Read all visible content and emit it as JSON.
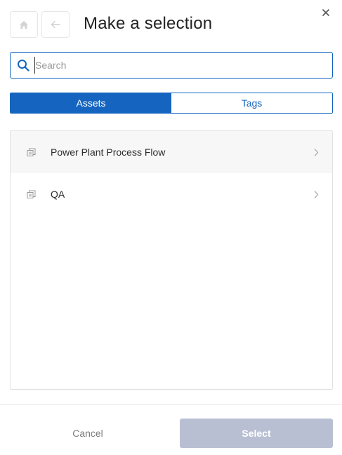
{
  "header": {
    "title": "Make a selection",
    "home_icon": "home-icon",
    "back_icon": "arrow-left-icon",
    "close_icon": "close-icon"
  },
  "search": {
    "placeholder": "Search",
    "value": "",
    "icon": "search-icon"
  },
  "tabs": [
    {
      "label": "Assets",
      "active": true
    },
    {
      "label": "Tags",
      "active": false
    }
  ],
  "list": {
    "items": [
      {
        "label": "Power Plant Process Flow",
        "icon": "asset-icon",
        "chevron": "chevron-right-icon"
      },
      {
        "label": "QA",
        "icon": "asset-icon",
        "chevron": "chevron-right-icon"
      }
    ]
  },
  "footer": {
    "cancel_label": "Cancel",
    "select_label": "Select"
  },
  "colors": {
    "accent": "#1565c0",
    "select_disabled": "#b9bfd3"
  }
}
